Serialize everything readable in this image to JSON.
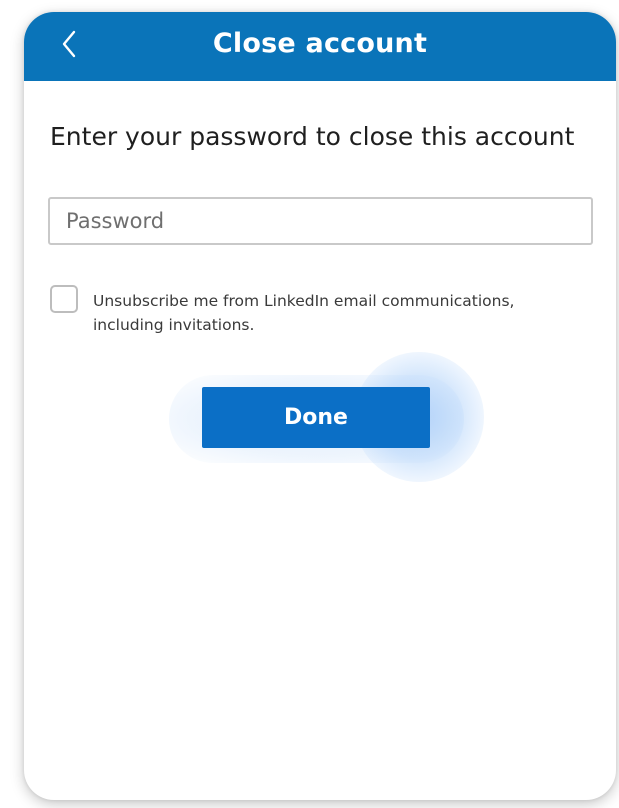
{
  "colors": {
    "header_background": "#0a74b9",
    "primary_button": "#0b6fc6",
    "field_border": "#c9c9c9"
  },
  "header": {
    "back_icon": "chevron-left-icon",
    "title": "Close account"
  },
  "form": {
    "prompt": "Enter your password to close this account",
    "password": {
      "value": "",
      "placeholder": "Password"
    },
    "unsubscribe": {
      "checked": false,
      "label": "Unsubscribe me from LinkedIn email communications, including invitations."
    },
    "done_label": "Done"
  }
}
